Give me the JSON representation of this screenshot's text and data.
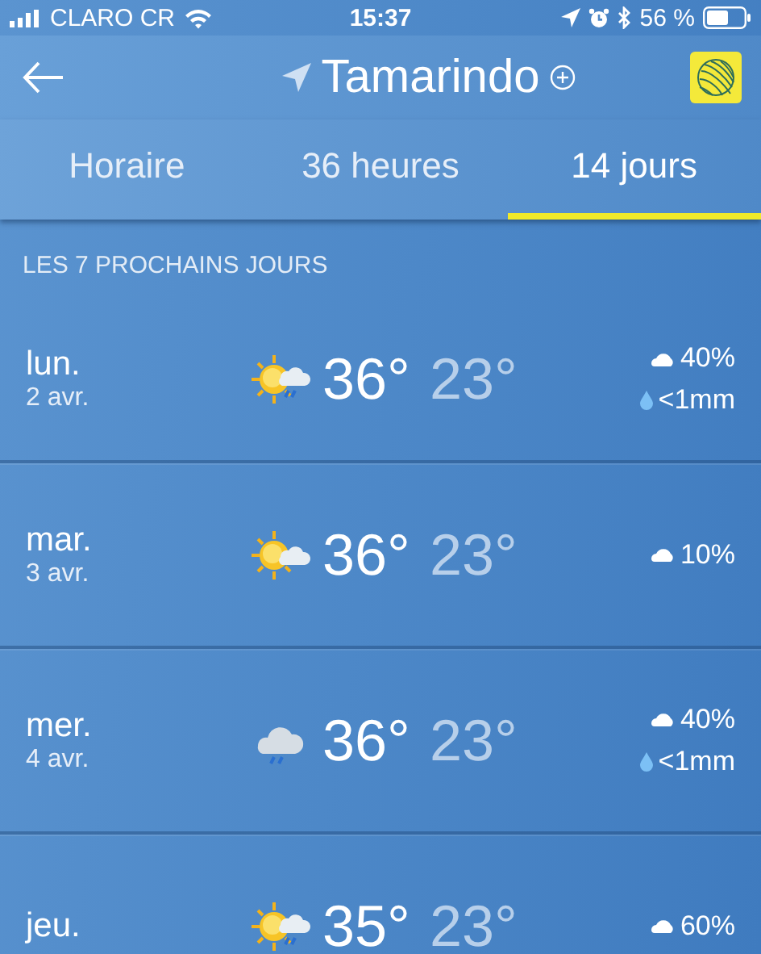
{
  "status_bar": {
    "carrier": "CLARO CR",
    "time": "15:37",
    "battery": "56 %"
  },
  "header": {
    "location": "Tamarindo"
  },
  "tabs": [
    {
      "label": "Horaire",
      "selected": false
    },
    {
      "label": "36 heures",
      "selected": false
    },
    {
      "label": "14 jours",
      "selected": true
    }
  ],
  "section_title": "LES 7 PROCHAINS JOURS",
  "days": [
    {
      "day": "lun.",
      "date": "2 avr.",
      "kind": "sun-cloud-rain",
      "high": "36°",
      "low": "23°",
      "chance": "40%",
      "rain": "<1mm"
    },
    {
      "day": "mar.",
      "date": "3 avr.",
      "kind": "sun-cloud",
      "high": "36°",
      "low": "23°",
      "chance": "10%"
    },
    {
      "day": "mer.",
      "date": "4 avr.",
      "kind": "cloud-rain",
      "high": "36°",
      "low": "23°",
      "chance": "40%",
      "rain": "<1mm"
    },
    {
      "day": "jeu.",
      "kind": "sun-cloud-rain",
      "high": "35°",
      "low": "23°",
      "chance": "60%"
    }
  ]
}
